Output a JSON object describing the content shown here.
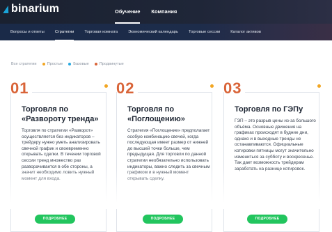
{
  "brand": {
    "name": "binarium"
  },
  "top_nav": [
    {
      "label": "Обучение"
    },
    {
      "label": "Компания"
    }
  ],
  "sub_nav": [
    {
      "label": "Вопросы и ответы"
    },
    {
      "label": "Стратегии"
    },
    {
      "label": "Торговая комната"
    },
    {
      "label": "Экономический календарь"
    },
    {
      "label": "Торговые сессии"
    },
    {
      "label": "Каталог активов"
    }
  ],
  "filters": {
    "all_label": "Все стратегии",
    "items": [
      {
        "label": "Простые",
        "color": "#f2a623"
      },
      {
        "label": "Базовые",
        "color": "#27a9e1"
      },
      {
        "label": "Продвинутые",
        "color": "#d96438"
      }
    ]
  },
  "cards": [
    {
      "number": "01",
      "title": "Торговля по «Развороту тренда»",
      "text": "Торговля по стратегии «Разворот» осуществляется без индикаторов – трейдеру нужно уметь анализировать свечной график и своевременно открывать сделки. В течении торговой сессии тренд множество раз разворачивается в обе стороны, а значит необходимо ловить нужный момент для входа.",
      "button": "ПОДРОБНЕЕ"
    },
    {
      "number": "02",
      "title": "Торговля по «Поглощению»",
      "text": "Стратегия «Поглощение» предполагает особую комбинацию свечей, когда последующая имеет размер от нижней до высшей точки больше, чем предыдущая. Для торговли по данной стратегии необязательно использовать индикаторы, важно следить за свечным графиком и в нужный момент открывать сделку.",
      "button": "ПОДРОБНЕЕ"
    },
    {
      "number": "03",
      "title": "Торговля по ГЭПу",
      "text": "ГЭП – это разрыв цены из-за большого объёма. Основные движения на графиках происходят в будние дни, однако и в выходные тренды не останавливаются. Официальные котировки пятницы могут значительно измениться за субботу и воскресенье. Так дает возможность трейдерам заработать на разнице котировок.",
      "button": "ПОДРОБНЕЕ"
    }
  ],
  "colors": {
    "accent_orange": "#d96438",
    "button_green": "#22c55e",
    "nav_dark": "#1a2130"
  }
}
